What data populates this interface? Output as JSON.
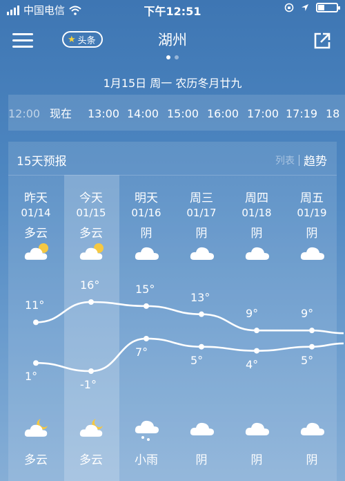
{
  "status": {
    "carrier": "中国电信",
    "time": "下午12:51"
  },
  "header": {
    "city": "湖州",
    "badge": "头条",
    "page_dots": 2,
    "page_index": 0
  },
  "date_line": "1月15日  周一  农历冬月廿九",
  "hourly": [
    "12:00",
    "现在",
    "13:00",
    "14:00",
    "15:00",
    "16:00",
    "17:00",
    "17:19",
    "18"
  ],
  "forecast": {
    "title": "15天预报",
    "view_list": "列表",
    "view_trend": "趋势",
    "days": [
      {
        "day": "昨天",
        "date": "01/14",
        "cond_day": "多云",
        "high": "11°",
        "low": "1°",
        "cond_night": "多云",
        "icon_day": "cloudy-sun-icon",
        "icon_night": "cloudy-moon-icon"
      },
      {
        "day": "今天",
        "date": "01/15",
        "cond_day": "多云",
        "high": "16°",
        "low": "-1°",
        "cond_night": "多云",
        "icon_day": "cloudy-sun-icon",
        "icon_night": "cloudy-moon-icon"
      },
      {
        "day": "明天",
        "date": "01/16",
        "cond_day": "阴",
        "high": "15°",
        "low": "7°",
        "cond_night": "小雨",
        "icon_day": "cloud-icon",
        "icon_night": "light-rain-icon"
      },
      {
        "day": "周三",
        "date": "01/17",
        "cond_day": "阴",
        "high": "13°",
        "low": "5°",
        "cond_night": "阴",
        "icon_day": "cloud-icon",
        "icon_night": "cloud-icon"
      },
      {
        "day": "周四",
        "date": "01/18",
        "cond_day": "阴",
        "high": "9°",
        "low": "4°",
        "cond_night": "阴",
        "icon_day": "cloud-icon",
        "icon_night": "cloud-icon"
      },
      {
        "day": "周五",
        "date": "01/19",
        "cond_day": "阴",
        "high": "9°",
        "low": "5°",
        "cond_night": "阴",
        "icon_day": "cloud-icon",
        "icon_night": "cloud-icon"
      }
    ],
    "highs": [
      11,
      16,
      15,
      13,
      9,
      9
    ],
    "lows": [
      1,
      -1,
      7,
      5,
      4,
      5
    ]
  },
  "colors": {
    "sun": "#f5c842",
    "cloud": "#ffffff"
  }
}
